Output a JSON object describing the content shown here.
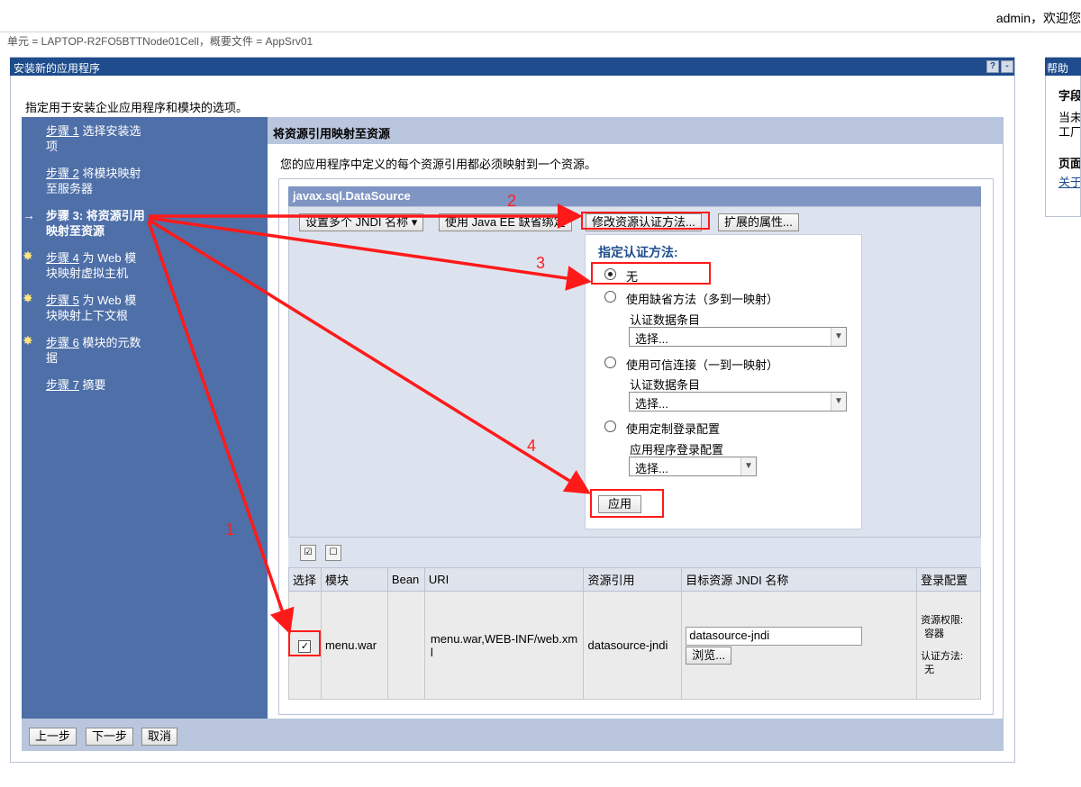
{
  "topbar": {
    "user_text": "admin，欢迎您"
  },
  "breadcrumb": "单元 = LAPTOP-R2FO5BTTNode01Cell，概要文件 = AppSrv01",
  "portlet": {
    "title": "安装新的应用程序",
    "help_btn": "?",
    "min_btn": "-"
  },
  "intro": "指定用于安装企业应用程序和模块的选项。",
  "wizard": {
    "steps": [
      {
        "num": "步骤 1",
        "label_a": "选择安装选",
        "label_b": "项"
      },
      {
        "num": "步骤 2",
        "label_a": "将模块映射",
        "label_b": "至服务器"
      },
      {
        "num": "步骤 3:",
        "label_a": "将资源引用",
        "label_b": "映射至资源"
      },
      {
        "num": "步骤 4",
        "label_a": "为 Web 模",
        "label_b": "块映射虚拟主机"
      },
      {
        "num": "步骤 5",
        "label_a": "为 Web 模",
        "label_b": "块映射上下文根"
      },
      {
        "num": "步骤 6",
        "label_a": "模块的元数",
        "label_b": "据"
      },
      {
        "num": "步骤 7",
        "label_a": "摘要",
        "label_b": ""
      }
    ],
    "current_arrow": "→",
    "star": "✸"
  },
  "content": {
    "header": "将资源引用映射至资源",
    "desc": "您的应用程序中定义的每个资源引用都必须映射到一个资源。",
    "ds_title": "javax.sql.DataSource",
    "buttons": {
      "multi_jndi": "设置多个 JNDI 名称 ▾",
      "javaee": "使用 Java EE 缺省绑定",
      "modify_auth": "修改资源认证方法...",
      "ext_props": "扩展的属性..."
    },
    "auth": {
      "title": "指定认证方法:",
      "opt_none": "无",
      "opt_default": "使用缺省方法（多到一映射）",
      "default_sub": "认证数据条目",
      "opt_trusted": "使用可信连接（一到一映射）",
      "trusted_sub": "认证数据条目",
      "opt_custom": "使用定制登录配置",
      "custom_sub": "应用程序登录配置",
      "select_placeholder": "选择...",
      "apply": "应用"
    },
    "table": {
      "headers": [
        "选择",
        "模块",
        "Bean",
        "URI",
        "资源引用",
        "目标资源 JNDI 名称",
        "登录配置"
      ],
      "row": {
        "checked": "✓",
        "module": "menu.war",
        "bean": "",
        "uri": "menu.war,WEB-INF/web.xml",
        "res_ref": "datasource-jndi",
        "jndi_value": "datasource-jndi",
        "browse": "浏览...",
        "login_a": "资源权限:",
        "login_b": "容器",
        "login_c": "认证方法:",
        "login_d": "无"
      }
    }
  },
  "footer": {
    "prev": "上一步",
    "next": "下一步",
    "cancel": "取消"
  },
  "help": {
    "title": "帮助",
    "field": "字段",
    "line1": "当未",
    "line2": "工厂",
    "page": "页面",
    "link": "关于"
  },
  "annotations": {
    "n1": "1",
    "n2": "2",
    "n3": "3",
    "n4": "4",
    "color": "#ff1a1a"
  },
  "colors": {
    "title_blue": "#1e4c8c",
    "wizard_blue": "#4e6fa8",
    "panel_blue": "#b9c6dd"
  }
}
